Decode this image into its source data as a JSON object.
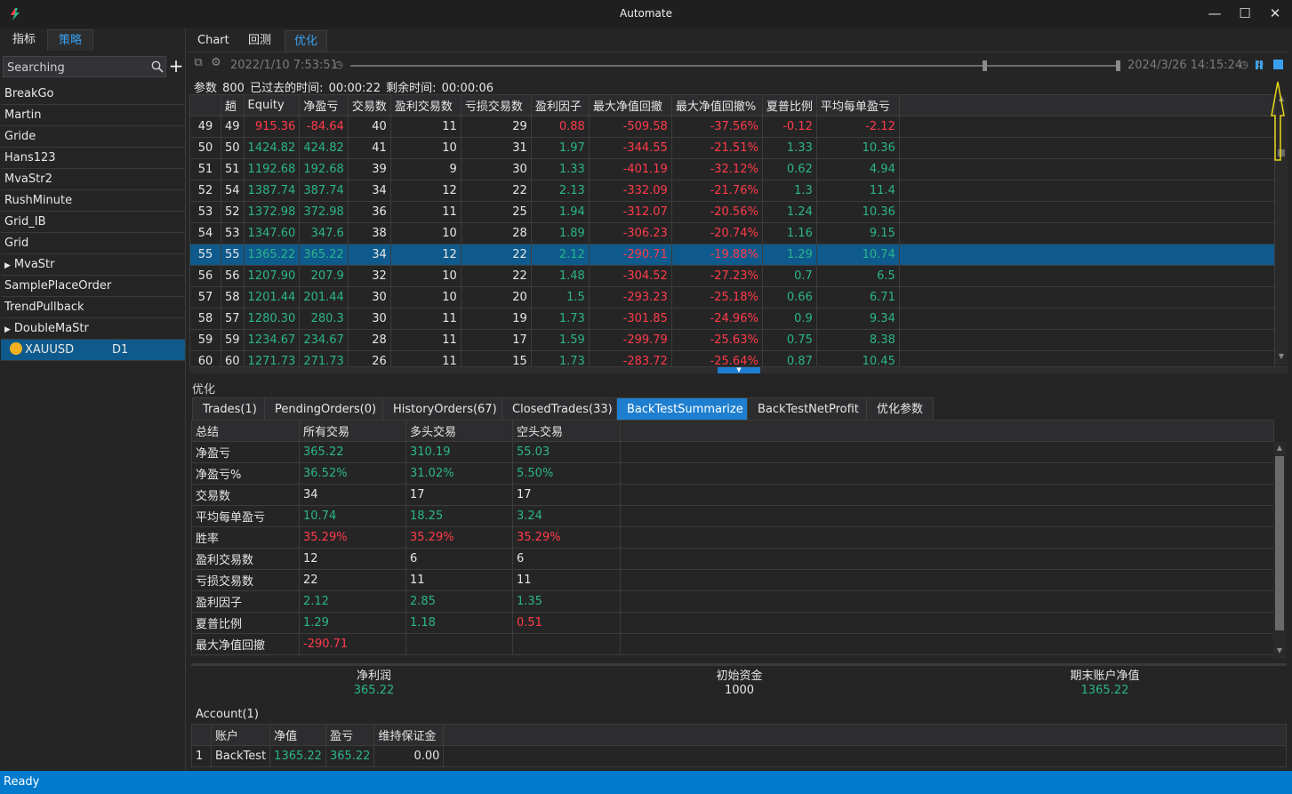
{
  "window": {
    "title": "Automate",
    "minimize": "—",
    "maximize": "☐",
    "close": "✕"
  },
  "left": {
    "tabs": [
      "指标",
      "策略"
    ],
    "search": {
      "placeholder": "Searching",
      "value": ""
    },
    "add_label": "+",
    "strategies": [
      {
        "name": "BreakGo"
      },
      {
        "name": "Martin"
      },
      {
        "name": "Gride"
      },
      {
        "name": "Hans123"
      },
      {
        "name": "MvaStr2"
      },
      {
        "name": "RushMinute"
      },
      {
        "name": "Grid_IB"
      },
      {
        "name": "Grid"
      },
      {
        "name": "MvaStr",
        "expandable": true
      },
      {
        "name": "SamplePlaceOrder"
      },
      {
        "name": "TrendPullback"
      },
      {
        "name": "DoubleMaStr",
        "expandable": true
      }
    ],
    "selected_symbol": {
      "symbol": "XAUUSD",
      "timeframe": "D1"
    }
  },
  "main_tabs": [
    "Chart",
    "回测",
    "优化"
  ],
  "toolbar": {
    "start_date": "2022/1/10 7:53:51",
    "end_date": "2024/3/26 14:15:24",
    "slider_start": 0.825,
    "slider_end": 1.0
  },
  "status_line": "参数 800   已过去的时间: 00:00:22   剩余时间: 00:00:06",
  "grid": {
    "headers": [
      "",
      "趟",
      "Equity",
      "净盈亏",
      "交易数",
      "盈利交易数",
      "亏损交易数",
      "盈利因子",
      "最大净值回撤",
      "最大净值回撤%",
      "夏普比例",
      "平均每单盈亏"
    ],
    "rows": [
      [
        "49",
        "49",
        "915.36",
        "-84.64",
        "40",
        "11",
        "29",
        "0.88",
        "-509.58",
        "-37.56%",
        "-0.12",
        "-2.12"
      ],
      [
        "50",
        "50",
        "1424.82",
        "424.82",
        "41",
        "10",
        "31",
        "1.97",
        "-344.55",
        "-21.51%",
        "1.33",
        "10.36"
      ],
      [
        "51",
        "51",
        "1192.68",
        "192.68",
        "39",
        "9",
        "30",
        "1.33",
        "-401.19",
        "-32.12%",
        "0.62",
        "4.94"
      ],
      [
        "52",
        "54",
        "1387.74",
        "387.74",
        "34",
        "12",
        "22",
        "2.13",
        "-332.09",
        "-21.76%",
        "1.3",
        "11.4"
      ],
      [
        "53",
        "52",
        "1372.98",
        "372.98",
        "36",
        "11",
        "25",
        "1.94",
        "-312.07",
        "-20.56%",
        "1.24",
        "10.36"
      ],
      [
        "54",
        "53",
        "1347.60",
        "347.6",
        "38",
        "10",
        "28",
        "1.89",
        "-306.23",
        "-20.74%",
        "1.16",
        "9.15"
      ],
      [
        "55",
        "55",
        "1365.22",
        "365.22",
        "34",
        "12",
        "22",
        "2.12",
        "-290.71",
        "-19.88%",
        "1.29",
        "10.74"
      ],
      [
        "56",
        "56",
        "1207.90",
        "207.9",
        "32",
        "10",
        "22",
        "1.48",
        "-304.52",
        "-27.23%",
        "0.7",
        "6.5"
      ],
      [
        "57",
        "58",
        "1201.44",
        "201.44",
        "30",
        "10",
        "20",
        "1.5",
        "-293.23",
        "-25.18%",
        "0.66",
        "6.71"
      ],
      [
        "58",
        "57",
        "1280.30",
        "280.3",
        "30",
        "11",
        "19",
        "1.73",
        "-301.85",
        "-24.96%",
        "0.9",
        "9.34"
      ],
      [
        "59",
        "59",
        "1234.67",
        "234.67",
        "28",
        "11",
        "17",
        "1.59",
        "-299.79",
        "-25.63%",
        "0.75",
        "8.38"
      ],
      [
        "60",
        "60",
        "1271.73",
        "271.73",
        "26",
        "11",
        "15",
        "1.73",
        "-283.72",
        "-25.64%",
        "0.87",
        "10.45"
      ]
    ],
    "selected_row": 6
  },
  "bottom": {
    "label": "优化",
    "tabs": [
      "Trades(1)",
      "PendingOrders(0)",
      "HistoryOrders(67)",
      "ClosedTrades(33)",
      "BackTestSummarize",
      "BackTestNetProfit",
      "优化参数"
    ],
    "active_tab": 4,
    "summary_headers": [
      "总结",
      "所有交易",
      "多头交易",
      "空头交易"
    ],
    "summary_rows": [
      [
        "净盈亏",
        "365.22",
        "310.19",
        "55.03"
      ],
      [
        "净盈亏%",
        "36.52%",
        "31.02%",
        "5.50%"
      ],
      [
        "交易数",
        "34",
        "17",
        "17"
      ],
      [
        "平均每单盈亏",
        "10.74",
        "18.25",
        "3.24"
      ],
      [
        "胜率",
        "35.29%",
        "35.29%",
        "35.29%"
      ],
      [
        "盈利交易数",
        "12",
        "6",
        "6"
      ],
      [
        "亏损交易数",
        "22",
        "11",
        "11"
      ],
      [
        "盈利因子",
        "2.12",
        "2.85",
        "1.35"
      ],
      [
        "夏普比例",
        "1.29",
        "1.18",
        "0.51"
      ],
      [
        "最大净值回撤",
        "-290.71",
        "",
        ""
      ]
    ],
    "summary_colors": [
      [
        "w",
        "pos",
        "pos",
        "pos"
      ],
      [
        "w",
        "pos",
        "pos",
        "pos"
      ],
      [
        "w",
        "w",
        "w",
        "w"
      ],
      [
        "w",
        "pos",
        "pos",
        "pos"
      ],
      [
        "w",
        "neg",
        "neg",
        "neg"
      ],
      [
        "w",
        "w",
        "w",
        "w"
      ],
      [
        "w",
        "w",
        "w",
        "w"
      ],
      [
        "w",
        "pos",
        "pos",
        "pos"
      ],
      [
        "w",
        "pos",
        "pos",
        "neg"
      ],
      [
        "w",
        "neg",
        "w",
        "w"
      ]
    ],
    "totals": {
      "net_profit_label": "净利润",
      "net_profit": "365.22",
      "initial_label": "初始资金",
      "initial": "1000",
      "final_label": "期末账户净值",
      "final": "1365.22"
    },
    "account_label": "Account(1)",
    "account_headers": [
      "",
      "账户",
      "净值",
      "盈亏",
      "维持保证金"
    ],
    "account_rows": [
      [
        "1",
        "BackTest",
        "1365.22",
        "365.22",
        "0.00"
      ]
    ]
  },
  "status_bar": "Ready",
  "colors": {
    "positive": "#2bb58a",
    "negative": "#ff3b4a",
    "accent": "#007acc",
    "selection": "#0e5a8c"
  }
}
